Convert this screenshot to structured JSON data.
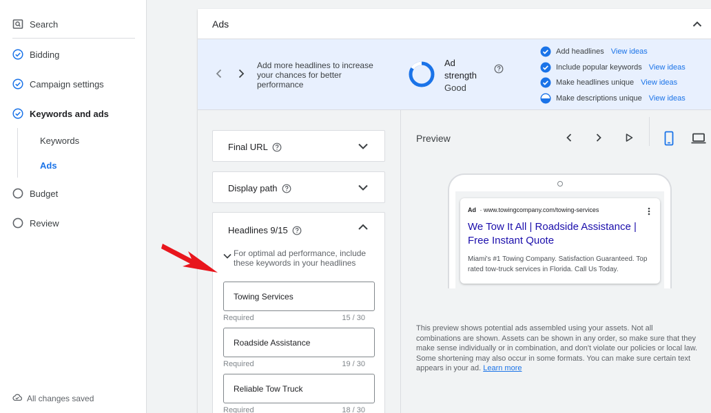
{
  "sidebar": {
    "items": [
      {
        "label": "Search",
        "icon": "search-box-icon"
      },
      {
        "label": "Bidding",
        "icon": "check-circle-icon"
      },
      {
        "label": "Campaign settings",
        "icon": "check-circle-icon"
      },
      {
        "label": "Keywords and ads",
        "icon": "check-circle-icon"
      },
      {
        "label": "Budget",
        "icon": "empty-circle-icon"
      },
      {
        "label": "Review",
        "icon": "empty-circle-icon"
      }
    ],
    "sub_items": [
      {
        "label": "Keywords"
      },
      {
        "label": "Ads",
        "active": true
      }
    ],
    "status": "All changes saved"
  },
  "card": {
    "title": "Ads"
  },
  "banner": {
    "tip": "Add more headlines to increase your chances for better performance",
    "strength_label": "Ad strength",
    "strength_value": "Good",
    "checklist": [
      {
        "label": "Add headlines",
        "link": "View ideas",
        "state": "done"
      },
      {
        "label": "Include popular keywords",
        "link": "View ideas",
        "state": "done"
      },
      {
        "label": "Make headlines unique",
        "link": "View ideas",
        "state": "done"
      },
      {
        "label": "Make descriptions unique",
        "link": "View ideas",
        "state": "partial"
      }
    ]
  },
  "editor": {
    "final_url_label": "Final URL",
    "display_path_label": "Display path",
    "headlines_label": "Headlines 9/15",
    "hint": "For optimal ad performance, include these keywords in your headlines",
    "headlines": [
      {
        "value": "Towing Services",
        "meta": "Required",
        "count": "15 / 30"
      },
      {
        "value": "Roadside Assistance",
        "meta": "Required",
        "count": "19 / 30"
      },
      {
        "value": "Reliable Tow Truck",
        "meta": "Required",
        "count": "18 / 30"
      }
    ]
  },
  "preview": {
    "title": "Preview",
    "ad_badge": "Ad",
    "ad_url": "www.towingcompany.com/towing-services",
    "ad_headline": "We Tow It All | Roadside Assistance | Free Instant Quote",
    "ad_description": "Miami's #1 Towing Company. Satisfaction Guaranteed. Top rated tow-truck services in Florida. Call Us Today.",
    "disclaimer": "This preview shows potential ads assembled using your assets. Not all combinations are shown. Assets can be shown in any order, so make sure that they make sense individually or in combination, and don't violate our policies or local law. Some shortening may also occur in some formats. You can make sure certain text appears in your ad.",
    "learn_more": "Learn more"
  },
  "colors": {
    "accent": "#1a73e8",
    "banner_bg": "#e8f0fe",
    "annotation": "#e8161d"
  }
}
